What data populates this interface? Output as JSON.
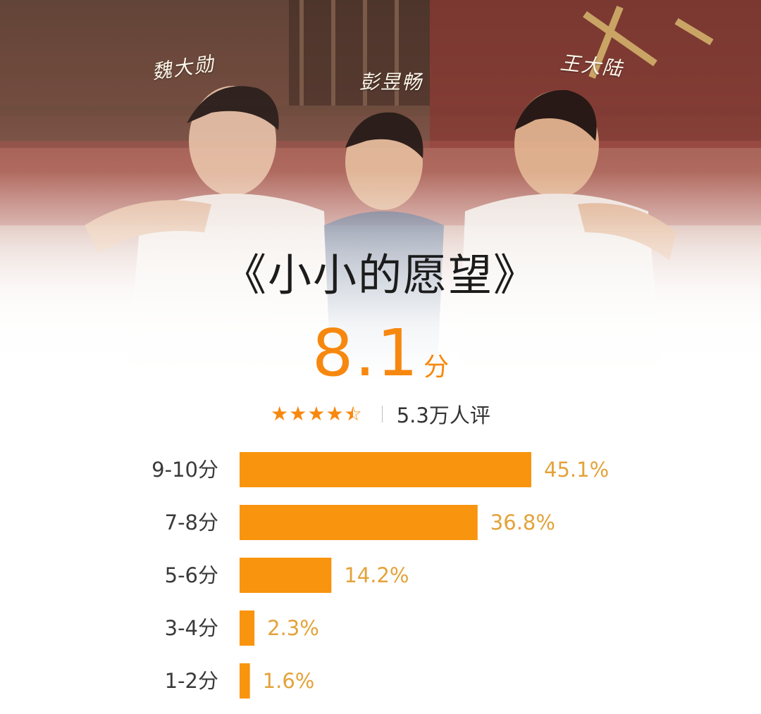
{
  "poster": {
    "actor_names": [
      "魏大勋",
      "彭昱畅",
      "王大陆"
    ]
  },
  "movie": {
    "title": "《小小的愿望》",
    "score": "8.1",
    "score_unit": "分"
  },
  "rating_summary": {
    "stars": 4.5,
    "count_label": "5.3万人评"
  },
  "colors": {
    "accent": "#f7880f",
    "bar": "#f9940e",
    "percent_text": "#e3a33a"
  },
  "chart_data": {
    "type": "bar",
    "orientation": "horizontal",
    "categories": [
      "9-10分",
      "7-8分",
      "5-6分",
      "3-4分",
      "1-2分"
    ],
    "values": [
      45.1,
      36.8,
      14.2,
      2.3,
      1.6
    ],
    "value_labels": [
      "45.1%",
      "36.8%",
      "14.2%",
      "2.3%",
      "1.6%"
    ],
    "title": "",
    "xlabel": "",
    "ylabel": "",
    "xlim": [
      0,
      45.1
    ]
  }
}
